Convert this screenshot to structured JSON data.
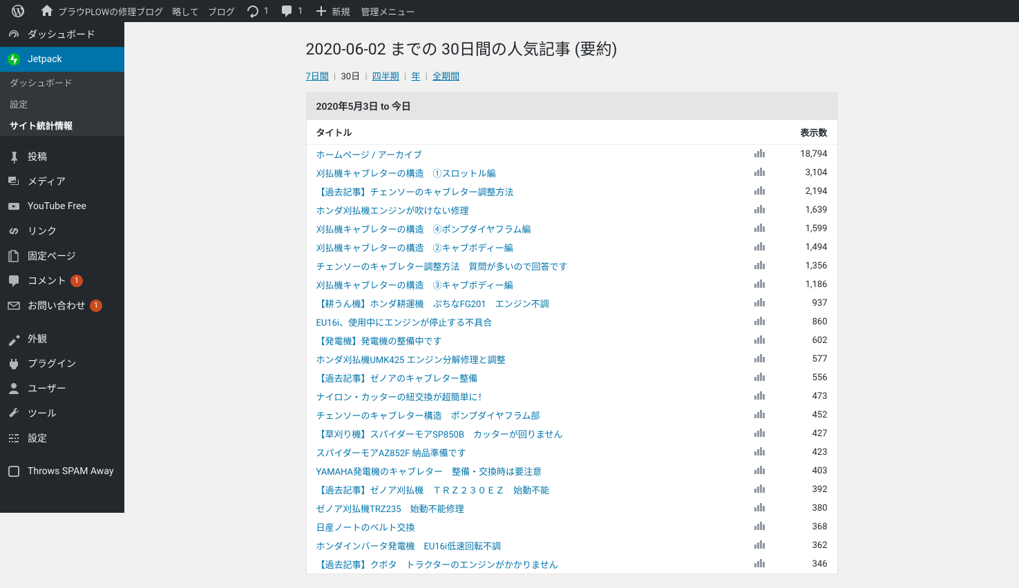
{
  "adminbar": {
    "site_name": "プラウPLOWの修理ブログ　略して　ブログ",
    "updates_count": "1",
    "comments_count": "1",
    "new_label": "新規",
    "admin_menu_label": "管理メニュー"
  },
  "sidebar": {
    "dashboard": "ダッシュボード",
    "jetpack": "Jetpack",
    "jetpack_sub": {
      "dashboard": "ダッシュボード",
      "settings": "設定",
      "site_stats": "サイト統計情報"
    },
    "posts": "投稿",
    "media": "メディア",
    "youtube": "YouTube Free",
    "links": "リンク",
    "pages": "固定ページ",
    "comments": "コメント",
    "comments_badge": "1",
    "contact": "お問い合わせ",
    "contact_badge": "1",
    "appearance": "外観",
    "plugins": "プラグイン",
    "users": "ユーザー",
    "tools": "ツール",
    "settings": "設定",
    "throws_spam": "Throws SPAM Away"
  },
  "page": {
    "title": "2020-06-02 までの 30日間の人気記事 (要約)",
    "periods": {
      "seven_days": "7日間",
      "thirty_days": "30日",
      "quarter": "四半期",
      "year": "年",
      "all_time": "全期間"
    },
    "range_label": "2020年5月3日 to 今日",
    "columns": {
      "title": "タイトル",
      "views": "表示数"
    },
    "rows": [
      {
        "title": "ホームページ / アーカイブ",
        "views": "18,794"
      },
      {
        "title": "刈払機キャブレターの構造　①スロットル編",
        "views": "3,104"
      },
      {
        "title": "【過去記事】チェンソーのキャブレター調整方法",
        "views": "2,194"
      },
      {
        "title": "ホンダ刈払機エンジンが吹けない修理",
        "views": "1,639"
      },
      {
        "title": "刈払機キャブレターの構造　④ポンプダイヤフラム編",
        "views": "1,599"
      },
      {
        "title": "刈払機キャブレターの構造　②キャブボディー編",
        "views": "1,494"
      },
      {
        "title": "チェンソーのキャブレター調整方法　質問が多いので回答です",
        "views": "1,356"
      },
      {
        "title": "刈払機キャブレターの構造　③キャブボディー編",
        "views": "1,186"
      },
      {
        "title": "【耕うん機】ホンダ耕運機　ぷちなFG201　エンジン不調",
        "views": "937"
      },
      {
        "title": "EU16i、使用中にエンジンが停止する不具合",
        "views": "860"
      },
      {
        "title": "【発電機】発電機の整備中です",
        "views": "602"
      },
      {
        "title": "ホンダ刈払機UMK425 エンジン分解修理と調整",
        "views": "577"
      },
      {
        "title": "【過去記事】ゼノアのキャブレター整備",
        "views": "556"
      },
      {
        "title": "ナイロン・カッターの紐交換が超簡単に！",
        "views": "473"
      },
      {
        "title": "チェンソーのキャブレター構造　ポンプダイヤフラム部",
        "views": "452"
      },
      {
        "title": "【草刈り機】スパイダーモアSP850B　カッターが回りません",
        "views": "427"
      },
      {
        "title": "スパイダーモアAZ852F 納品準備です",
        "views": "423"
      },
      {
        "title": "YAMAHA発電機のキャブレター　整備・交換時は要注意",
        "views": "403"
      },
      {
        "title": "【過去記事】ゼノア刈払機　ＴＲＺ２３０ＥＺ　始動不能",
        "views": "392"
      },
      {
        "title": "ゼノア刈払機TRZ235　始動不能修理",
        "views": "380"
      },
      {
        "title": "日産ノートのベルト交換",
        "views": "368"
      },
      {
        "title": "ホンダインバータ発電機　EU16i低速回転不調",
        "views": "362"
      },
      {
        "title": "【過去記事】クボタ　トラクターのエンジンがかかりません",
        "views": "346"
      }
    ]
  }
}
